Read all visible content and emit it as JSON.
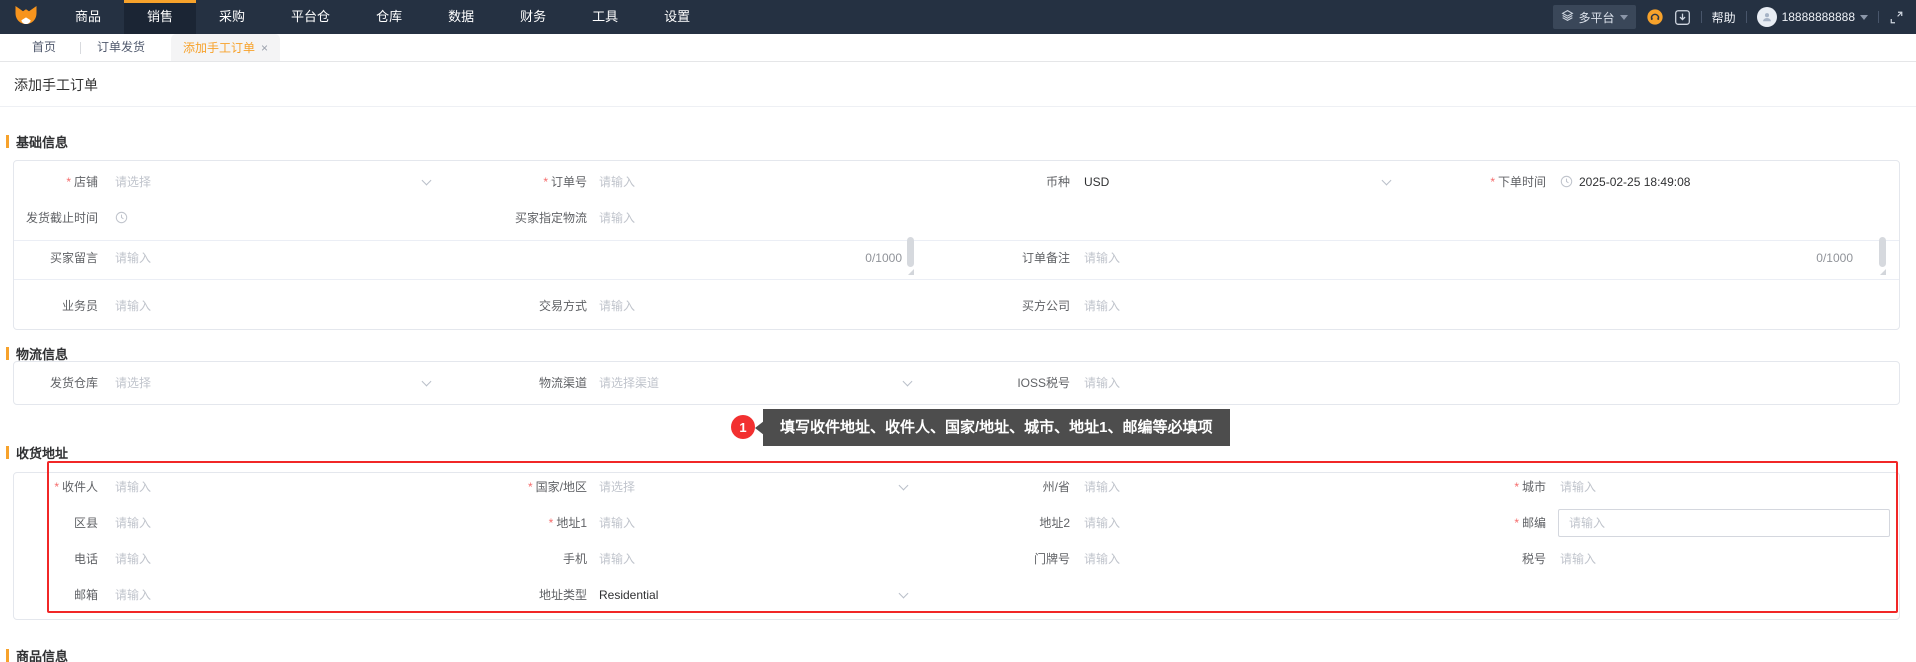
{
  "colors": {
    "accent": "#f7a22b",
    "navbar_bg": "#253142",
    "required": "#f56c6c",
    "annotation_red": "#f12727",
    "tooltip_bg": "#4d4d4d",
    "placeholder": "#c0c4cc"
  },
  "marks": {
    "required": "*",
    "close": "×"
  },
  "navbar": {
    "menu": [
      {
        "label": "商品"
      },
      {
        "label": "销售"
      },
      {
        "label": "采购"
      },
      {
        "label": "平台仓"
      },
      {
        "label": "仓库"
      },
      {
        "label": "数据"
      },
      {
        "label": "财务"
      },
      {
        "label": "工具"
      },
      {
        "label": "设置"
      }
    ],
    "platform": {
      "label": "多平台"
    },
    "help": "帮助",
    "phone": "18888888888"
  },
  "tabs": {
    "home": "首页",
    "shipping": "订单发货",
    "current": "添加手工订单"
  },
  "page": {
    "title": "添加手工订单"
  },
  "basic": {
    "title": "基础信息",
    "shop": {
      "label": "店铺",
      "placeholder": "请选择"
    },
    "order_no": {
      "label": "订单号",
      "placeholder": "请输入"
    },
    "currency": {
      "label": "币种",
      "value": "USD"
    },
    "order_time": {
      "label": "下单时间",
      "value": "2025-02-25 18:49:08"
    },
    "ship_deadline": {
      "label": "发货截止时间"
    },
    "buyer_logistics": {
      "label": "买家指定物流",
      "placeholder": "请输入"
    },
    "buyer_message": {
      "label": "买家留言",
      "placeholder": "请输入",
      "counter": "0/1000"
    },
    "order_remark": {
      "label": "订单备注",
      "placeholder": "请输入",
      "counter": "0/1000"
    },
    "salesman": {
      "label": "业务员",
      "placeholder": "请输入"
    },
    "trade_mode": {
      "label": "交易方式",
      "placeholder": "请输入"
    },
    "buyer_company": {
      "label": "买方公司",
      "placeholder": "请输入"
    }
  },
  "logistics": {
    "title": "物流信息",
    "warehouse": {
      "label": "发货仓库",
      "placeholder": "请选择"
    },
    "channel": {
      "label": "物流渠道",
      "placeholder": "请选择渠道"
    },
    "ioss": {
      "label": "IOSS税号",
      "placeholder": "请输入"
    }
  },
  "annotation": {
    "step": "1",
    "text": "填写收件地址、收件人、国家/地址、城市、地址1、邮编等必填项"
  },
  "address": {
    "title": "收货地址",
    "consignee": {
      "label": "收件人",
      "placeholder": "请输入"
    },
    "country": {
      "label": "国家/地区",
      "placeholder": "请选择"
    },
    "state": {
      "label": "州/省",
      "placeholder": "请输入"
    },
    "city": {
      "label": "城市",
      "placeholder": "请输入"
    },
    "district": {
      "label": "区县",
      "placeholder": "请输入"
    },
    "address1": {
      "label": "地址1",
      "placeholder": "请输入"
    },
    "address2": {
      "label": "地址2",
      "placeholder": "请输入"
    },
    "zip": {
      "label": "邮编",
      "placeholder": "请输入"
    },
    "phone": {
      "label": "电话",
      "placeholder": "请输入"
    },
    "mobile": {
      "label": "手机",
      "placeholder": "请输入"
    },
    "house_no": {
      "label": "门牌号",
      "placeholder": "请输入"
    },
    "tax_no": {
      "label": "税号",
      "placeholder": "请输入"
    },
    "email": {
      "label": "邮箱",
      "placeholder": "请输入"
    },
    "addr_type": {
      "label": "地址类型",
      "value": "Residential"
    }
  },
  "products": {
    "title": "商品信息"
  }
}
